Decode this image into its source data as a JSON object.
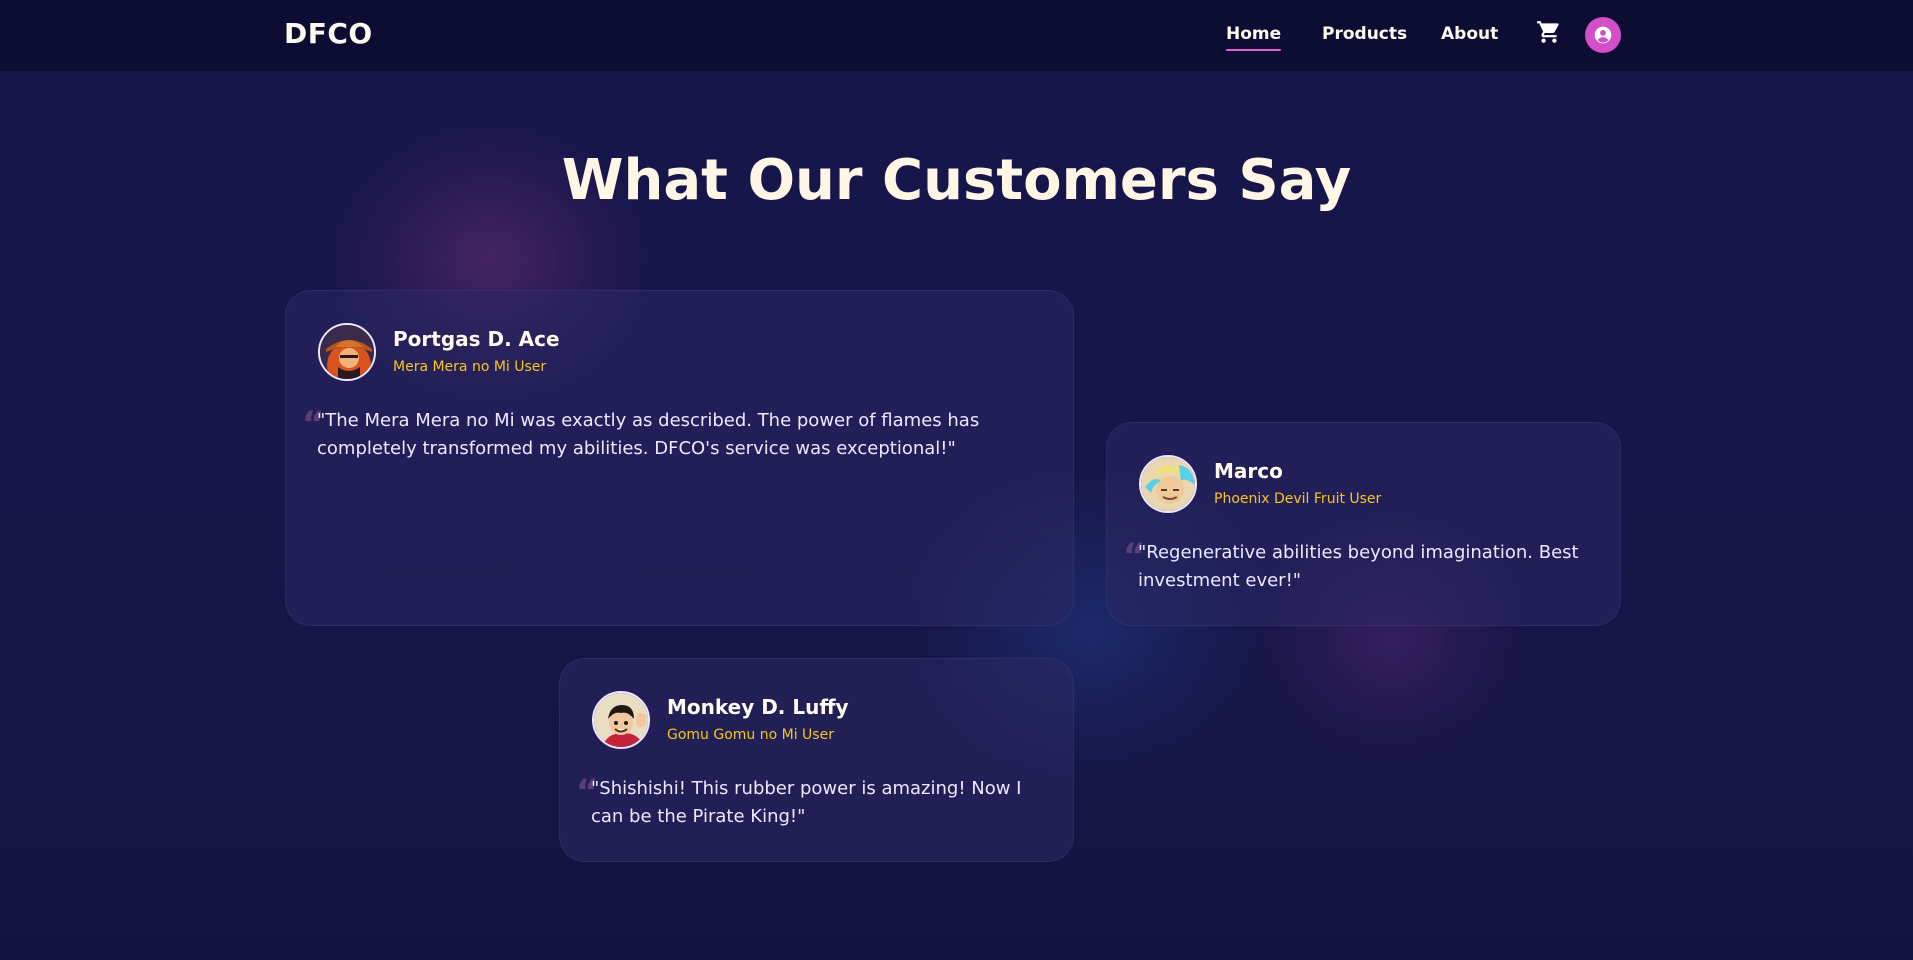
{
  "nav": {
    "logo": "DFCO",
    "links": [
      "Home",
      "Products",
      "About"
    ],
    "cart_icon": "cart-icon",
    "profile_icon": "user-circle-icon",
    "accent_color": "#d24fc8"
  },
  "testimonials": {
    "title": "What Our Customers Say",
    "items": [
      {
        "name": "Portgas D. Ace",
        "role": "Mera Mera no Mi User",
        "quote": "\"The Mera Mera no Mi was exactly as described. The power of flames has completely transformed my abilities. DFCO's service was exceptional!\""
      },
      {
        "name": "Marco",
        "role": "Phoenix Devil Fruit User",
        "quote": "\"Regenerative abilities beyond imagination. Best investment ever!\""
      },
      {
        "name": "Monkey D. Luffy",
        "role": "Gomu Gomu no Mi User",
        "quote": "\"Shishishi! This rubber power is amazing! Now I can be the Pirate King!\""
      }
    ],
    "quote_mark": "“"
  },
  "colors": {
    "background": "#17164a",
    "navbar": "#0d0d33",
    "role_text": "#f5c518",
    "heading": "#fff6e6"
  }
}
